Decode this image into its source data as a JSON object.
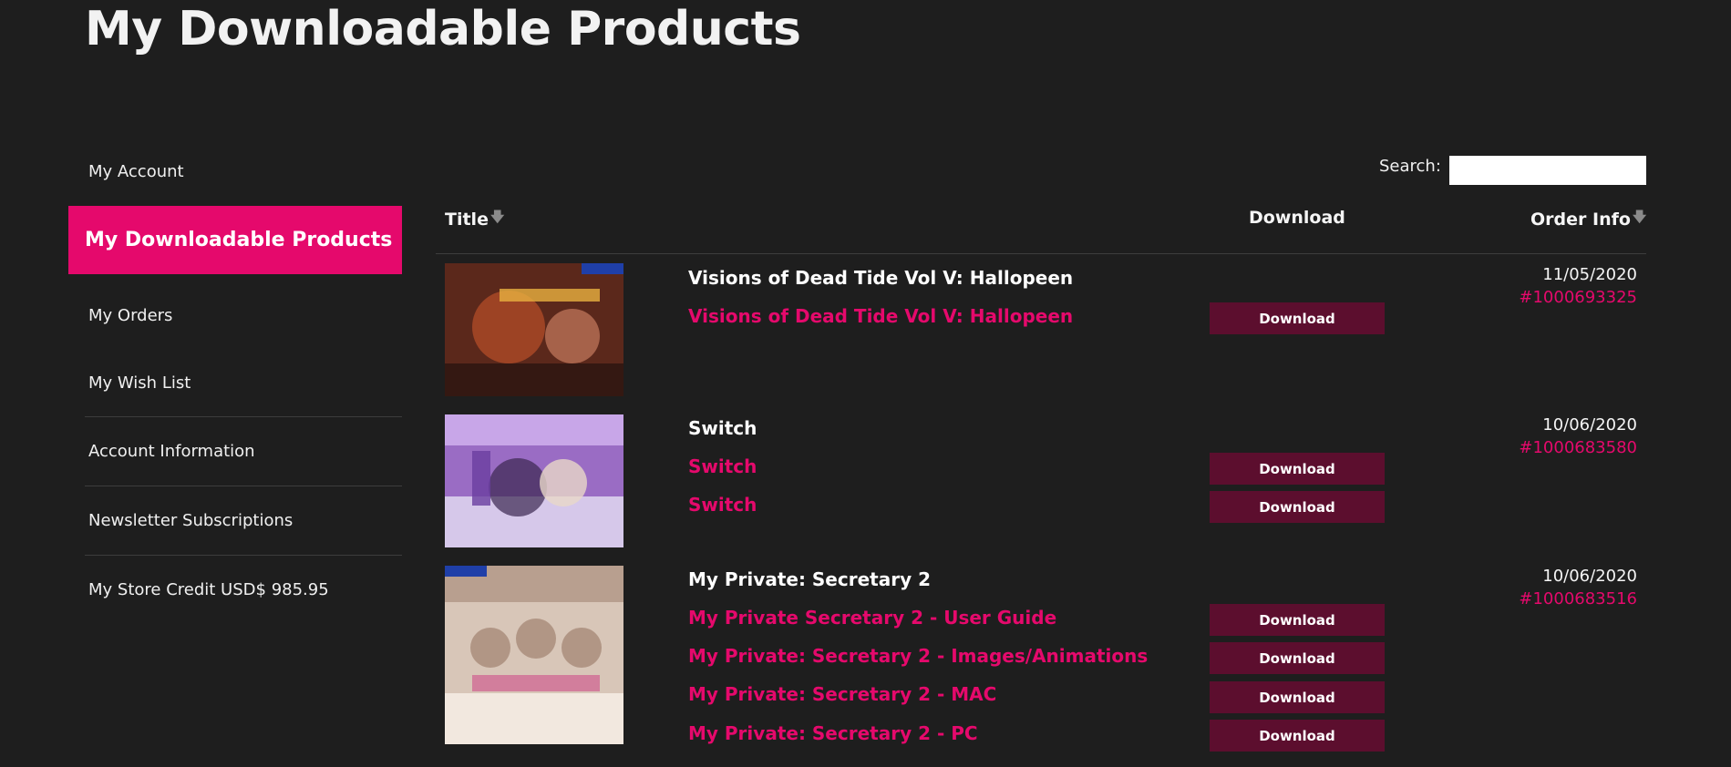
{
  "page": {
    "title": "My Downloadable Products"
  },
  "sidebar": {
    "items": [
      {
        "label": "My Account"
      },
      {
        "label": "My Downloadable Products"
      },
      {
        "label": "My Orders"
      },
      {
        "label": "My Wish List"
      },
      {
        "label": "Account Information"
      },
      {
        "label": "Newsletter Subscriptions"
      },
      {
        "label": "My Store Credit USD$ 985.95"
      }
    ]
  },
  "search": {
    "label": "Search:",
    "value": ""
  },
  "table": {
    "headers": {
      "title": "Title",
      "download": "Download",
      "order_info": "Order Info",
      "sort_icon": "arrow-down-icon"
    },
    "rows": [
      {
        "name": "Visions of Dead Tide Vol V: Hallopeen",
        "date": "11/05/2020",
        "order": "#1000693325",
        "thumb_colors": [
          "#6a2f1f",
          "#c9552c",
          "#2a1410"
        ],
        "links": [
          {
            "title": "Visions of Dead Tide Vol V: Hallopeen",
            "button": "Download"
          }
        ]
      },
      {
        "name": "Switch",
        "date": "10/06/2020",
        "order": "#1000683580",
        "thumb_colors": [
          "#9a6cc4",
          "#c8a6e8",
          "#3a2650"
        ],
        "links": [
          {
            "title": "Switch",
            "button": "Download"
          },
          {
            "title": "Switch",
            "button": "Download"
          }
        ]
      },
      {
        "name": "My Private: Secretary 2",
        "date": "10/06/2020",
        "order": "#1000683516",
        "thumb_colors": [
          "#d8c6b8",
          "#b89f8f",
          "#f2e8df"
        ],
        "links": [
          {
            "title": "My Private Secretary 2 - User Guide",
            "button": "Download"
          },
          {
            "title": "My Private: Secretary 2 - Images/Animations",
            "button": "Download"
          },
          {
            "title": "My Private: Secretary 2 - MAC",
            "button": "Download"
          },
          {
            "title": "My Private: Secretary 2 - PC",
            "button": "Download"
          }
        ]
      }
    ]
  }
}
